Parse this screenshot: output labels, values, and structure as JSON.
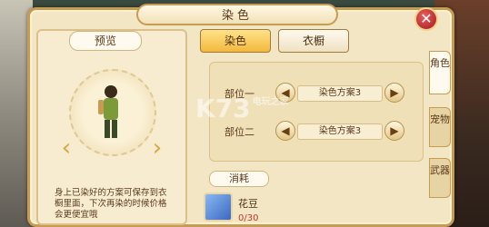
{
  "window": {
    "title": "染色",
    "close_label": "✕"
  },
  "preview": {
    "tab_label": "预览",
    "description": "身上已染好的方案可保存到衣橱里面，下次再染的时候价格会更便宜哦"
  },
  "top_buttons": {
    "dye": "染色",
    "wardrobe": "衣橱"
  },
  "parts": [
    {
      "label": "部位一",
      "value": "染色方案3"
    },
    {
      "label": "部位二",
      "value": "染色方案3"
    }
  ],
  "cost": {
    "title": "消耗",
    "item_name": "花豆",
    "item_count": "0/30"
  },
  "side_tabs": [
    "角色",
    "宠物",
    "武器"
  ],
  "watermark": {
    "text": "K73",
    "sub": "电玩之家"
  },
  "colors": {
    "accent": "#f3b83c",
    "border": "#c89b52",
    "panel": "#f3e6c5"
  }
}
